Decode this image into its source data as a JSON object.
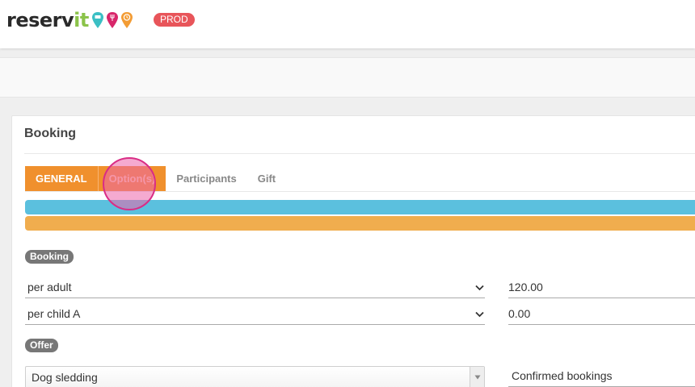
{
  "app": {
    "logo_main": "reserv",
    "logo_accent": "it",
    "env_badge": "PROD"
  },
  "panel": {
    "title": "Booking"
  },
  "tabs": [
    {
      "label": "GENERAL"
    },
    {
      "label": "Option(s)"
    },
    {
      "label": "Participants"
    },
    {
      "label": "Gift"
    }
  ],
  "sections": {
    "booking_label": "Booking",
    "offer_label": "Offer"
  },
  "price_rows": [
    {
      "type": "per adult",
      "value": "120.00"
    },
    {
      "type": "per child A",
      "value": "0.00"
    }
  ],
  "offer": {
    "selected": "Dog sledding",
    "status": "Confirmed bookings"
  },
  "colors": {
    "accent": "#f0902d",
    "info_bar": "#5bc0de",
    "warning_bar": "#f0ad4e",
    "badge": "#e8555a",
    "click_marker": "#d92d86"
  },
  "icons": [
    "pin-teal-icon",
    "pin-crimson-icon",
    "pin-orange-icon",
    "chevron-down-icon",
    "triangle-down-icon"
  ]
}
